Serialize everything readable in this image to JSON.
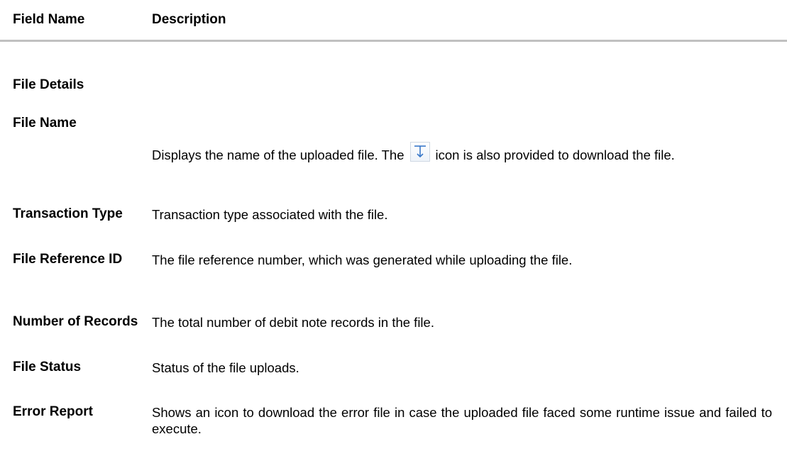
{
  "table": {
    "headers": {
      "field": "Field Name",
      "description": "Description"
    },
    "section_title": "File Details",
    "rows": [
      {
        "field": "File Name",
        "desc_before_icon": "Displays the name of the uploaded file. The",
        "icon": "download-icon",
        "desc_after_icon": "icon is also provided to download the file."
      },
      {
        "field": "Transaction Type",
        "description": "Transaction type associated with the file."
      },
      {
        "field": "File Reference ID",
        "description": "The file reference number, which was generated while uploading the file."
      },
      {
        "field": "Number of Records",
        "description": "The total number of debit note records in the file."
      },
      {
        "field": "File Status",
        "description": "Status of the file uploads."
      },
      {
        "field": "Error Report",
        "description": "Shows an icon to download the error file in case the uploaded file faced some runtime issue and failed to execute."
      }
    ]
  },
  "colors": {
    "rule": "#c0c0c0",
    "icon_stroke": "#3a78c9"
  }
}
